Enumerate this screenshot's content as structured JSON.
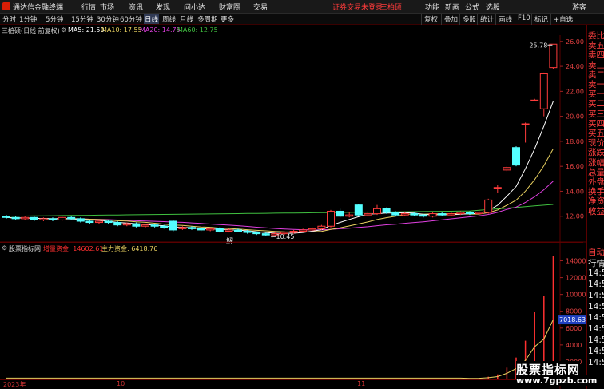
{
  "titlebar": {
    "app_name": "通达信金融终端",
    "menus": [
      "行情",
      "市场",
      "资讯",
      "发现",
      "问小达",
      "财富圈",
      "交易"
    ],
    "alert": "证券交易未登录",
    "stock_name": "三柏硕",
    "right_menus": [
      "功能",
      "新画",
      "公式",
      "选股",
      "游客"
    ]
  },
  "toolbar": {
    "periods": [
      "分时",
      "1分钟",
      "5分钟",
      "15分钟",
      "30分钟",
      "60分钟",
      "日线",
      "周线",
      "月线",
      "多周期",
      "更多"
    ],
    "active_period": "日线",
    "right_buttons": [
      "复权",
      "叠加",
      "多股",
      "统计",
      "画线",
      "F10",
      "标记",
      "+自选"
    ]
  },
  "infobar": {
    "title": "三柏硕(日线 前复权)",
    "ma5": "MA5: 21.50",
    "ma10": "MA10: 17.55",
    "ma20": "MA20: 14.75",
    "ma60": "MA60: 12.75",
    "colors": {
      "ma5": "#ffffff",
      "ma10": "#e8d060",
      "ma20": "#e040e0",
      "ma60": "#40c040"
    }
  },
  "price_axis": {
    "ticks": [
      "26.00",
      "24.00",
      "22.00",
      "20.00",
      "18.00",
      "16.00",
      "14.00",
      "12.00"
    ]
  },
  "annotations": {
    "high_label": "25.78",
    "low_label": "10.45",
    "jie_label": "解"
  },
  "subchart": {
    "title": "股票指标网",
    "field1": "增量资金: 14602.61",
    "field2": "主力资金: 6418.76",
    "field1_color": "#ff3030",
    "field2_color": "#e8d060",
    "current_badge": "7018.63",
    "ticks": [
      "14000",
      "12000",
      "10000",
      "8000",
      "6000",
      "4000",
      "2000"
    ]
  },
  "right_panel": {
    "top_items": [
      "委比",
      "卖五",
      "卖四",
      "卖三",
      "卖二",
      "卖一",
      "买一",
      "买二",
      "买三",
      "买四",
      "买五",
      "现价",
      "涨跌",
      "涨幅",
      "总量",
      "外盘",
      "换手",
      "净资",
      "收益"
    ],
    "bottom_items": [
      "自动",
      "行情",
      "14:5",
      "14:5",
      "14:5",
      "14:5",
      "14:5",
      "14:5",
      "14:5",
      "14:5",
      "14:5"
    ]
  },
  "bottom_axis": {
    "labels": [
      "2023年",
      "10",
      "11"
    ]
  },
  "watermark": {
    "text": "股票指标网",
    "url": "www.7gpzb.com"
  },
  "chart_data": {
    "type": "candlestick",
    "ylim": [
      10,
      26.5
    ],
    "candles": [
      {
        "o": 12.0,
        "c": 11.9,
        "h": 12.1,
        "l": 11.8
      },
      {
        "o": 11.9,
        "c": 11.8,
        "h": 12.0,
        "l": 11.7
      },
      {
        "o": 11.8,
        "c": 11.9,
        "h": 12.0,
        "l": 11.7
      },
      {
        "o": 11.9,
        "c": 11.7,
        "h": 12.0,
        "l": 11.6
      },
      {
        "o": 11.7,
        "c": 11.8,
        "h": 11.9,
        "l": 11.6
      },
      {
        "o": 11.8,
        "c": 11.7,
        "h": 11.9,
        "l": 11.6
      },
      {
        "o": 11.7,
        "c": 11.9,
        "h": 12.0,
        "l": 11.6
      },
      {
        "o": 11.9,
        "c": 11.8,
        "h": 12.0,
        "l": 11.7
      },
      {
        "o": 11.8,
        "c": 11.6,
        "h": 11.9,
        "l": 11.5
      },
      {
        "o": 11.6,
        "c": 11.5,
        "h": 11.7,
        "l": 11.4
      },
      {
        "o": 11.5,
        "c": 11.6,
        "h": 11.7,
        "l": 11.4
      },
      {
        "o": 11.6,
        "c": 11.5,
        "h": 11.7,
        "l": 11.4
      },
      {
        "o": 11.5,
        "c": 11.3,
        "h": 11.6,
        "l": 11.2
      },
      {
        "o": 11.3,
        "c": 11.4,
        "h": 11.5,
        "l": 11.2
      },
      {
        "o": 11.4,
        "c": 11.2,
        "h": 11.5,
        "l": 11.1
      },
      {
        "o": 11.2,
        "c": 11.3,
        "h": 11.4,
        "l": 11.1
      },
      {
        "o": 11.3,
        "c": 11.2,
        "h": 11.4,
        "l": 11.1
      },
      {
        "o": 11.2,
        "c": 11.1,
        "h": 11.3,
        "l": 11.0
      },
      {
        "o": 11.6,
        "c": 10.9,
        "h": 11.7,
        "l": 10.8
      },
      {
        "o": 11.0,
        "c": 11.1,
        "h": 11.2,
        "l": 10.9
      },
      {
        "o": 11.1,
        "c": 11.0,
        "h": 11.2,
        "l": 10.9
      },
      {
        "o": 11.0,
        "c": 10.9,
        "h": 11.1,
        "l": 10.8
      },
      {
        "o": 10.9,
        "c": 11.0,
        "h": 11.1,
        "l": 10.8
      },
      {
        "o": 11.0,
        "c": 10.8,
        "h": 11.1,
        "l": 10.7
      },
      {
        "o": 10.8,
        "c": 10.9,
        "h": 11.0,
        "l": 10.7
      },
      {
        "o": 10.9,
        "c": 10.8,
        "h": 11.0,
        "l": 10.7
      },
      {
        "o": 10.8,
        "c": 10.7,
        "h": 10.9,
        "l": 10.6
      },
      {
        "o": 10.7,
        "c": 10.6,
        "h": 10.8,
        "l": 10.5
      },
      {
        "o": 10.6,
        "c": 10.5,
        "h": 10.7,
        "l": 10.45
      },
      {
        "o": 10.5,
        "c": 10.6,
        "h": 10.7,
        "l": 10.45
      },
      {
        "o": 10.6,
        "c": 10.7,
        "h": 10.8,
        "l": 10.5
      },
      {
        "o": 10.7,
        "c": 10.8,
        "h": 10.9,
        "l": 10.6
      },
      {
        "o": 10.8,
        "c": 10.9,
        "h": 11.0,
        "l": 10.7
      },
      {
        "o": 10.9,
        "c": 11.0,
        "h": 11.1,
        "l": 10.8
      },
      {
        "o": 11.0,
        "c": 11.2,
        "h": 11.3,
        "l": 10.9
      },
      {
        "o": 11.2,
        "c": 12.4,
        "h": 12.5,
        "l": 11.1
      },
      {
        "o": 12.4,
        "c": 12.0,
        "h": 12.6,
        "l": 11.9
      },
      {
        "o": 12.0,
        "c": 12.1,
        "h": 12.3,
        "l": 11.9
      },
      {
        "o": 12.9,
        "c": 12.1,
        "h": 13.0,
        "l": 12.0
      },
      {
        "o": 12.1,
        "c": 12.2,
        "h": 12.4,
        "l": 12.0
      },
      {
        "o": 12.2,
        "c": 12.6,
        "h": 12.9,
        "l": 12.1
      },
      {
        "o": 12.6,
        "c": 12.3,
        "h": 12.7,
        "l": 12.2
      },
      {
        "o": 12.3,
        "c": 12.1,
        "h": 12.4,
        "l": 12.0
      },
      {
        "o": 12.1,
        "c": 12.2,
        "h": 12.3,
        "l": 12.0
      },
      {
        "o": 12.2,
        "c": 12.1,
        "h": 12.3,
        "l": 12.0
      },
      {
        "o": 12.1,
        "c": 12.0,
        "h": 12.2,
        "l": 11.9
      },
      {
        "o": 12.0,
        "c": 12.2,
        "h": 12.3,
        "l": 11.9
      },
      {
        "o": 12.2,
        "c": 12.1,
        "h": 12.3,
        "l": 12.0
      },
      {
        "o": 12.1,
        "c": 12.2,
        "h": 12.3,
        "l": 12.0
      },
      {
        "o": 12.2,
        "c": 12.3,
        "h": 12.4,
        "l": 12.1
      },
      {
        "o": 12.3,
        "c": 12.2,
        "h": 12.4,
        "l": 12.1
      },
      {
        "o": 12.2,
        "c": 12.3,
        "h": 12.5,
        "l": 12.1
      },
      {
        "o": 12.3,
        "c": 13.3,
        "h": 13.4,
        "l": 12.2
      },
      {
        "o": 14.3,
        "c": 14.3,
        "h": 14.5,
        "l": 13.9
      },
      {
        "o": 15.7,
        "c": 15.9,
        "h": 16.0,
        "l": 15.6
      },
      {
        "o": 17.5,
        "c": 16.1,
        "h": 17.6,
        "l": 16.0
      },
      {
        "o": 19.4,
        "c": 19.4,
        "h": 19.5,
        "l": 17.9
      },
      {
        "o": 21.3,
        "c": 21.3,
        "h": 21.4,
        "l": 21.3
      },
      {
        "o": 20.6,
        "c": 23.4,
        "h": 23.5,
        "l": 20.0
      },
      {
        "o": 23.9,
        "c": 25.78,
        "h": 25.78,
        "l": 23.8
      }
    ],
    "volume_bars": [
      12,
      14,
      13,
      15,
      14,
      16,
      15,
      14,
      13,
      15,
      14,
      13,
      12,
      14,
      13,
      12,
      13,
      12,
      14,
      13,
      12,
      13,
      12,
      13,
      12,
      13,
      12,
      14,
      15,
      16,
      18,
      20,
      24,
      26,
      30,
      55,
      48,
      44,
      52,
      50,
      60,
      58,
      54,
      50,
      48,
      52,
      56,
      58,
      60,
      62,
      64,
      70,
      220,
      500,
      1300,
      2500,
      4500,
      7900,
      9800,
      14602
    ]
  }
}
